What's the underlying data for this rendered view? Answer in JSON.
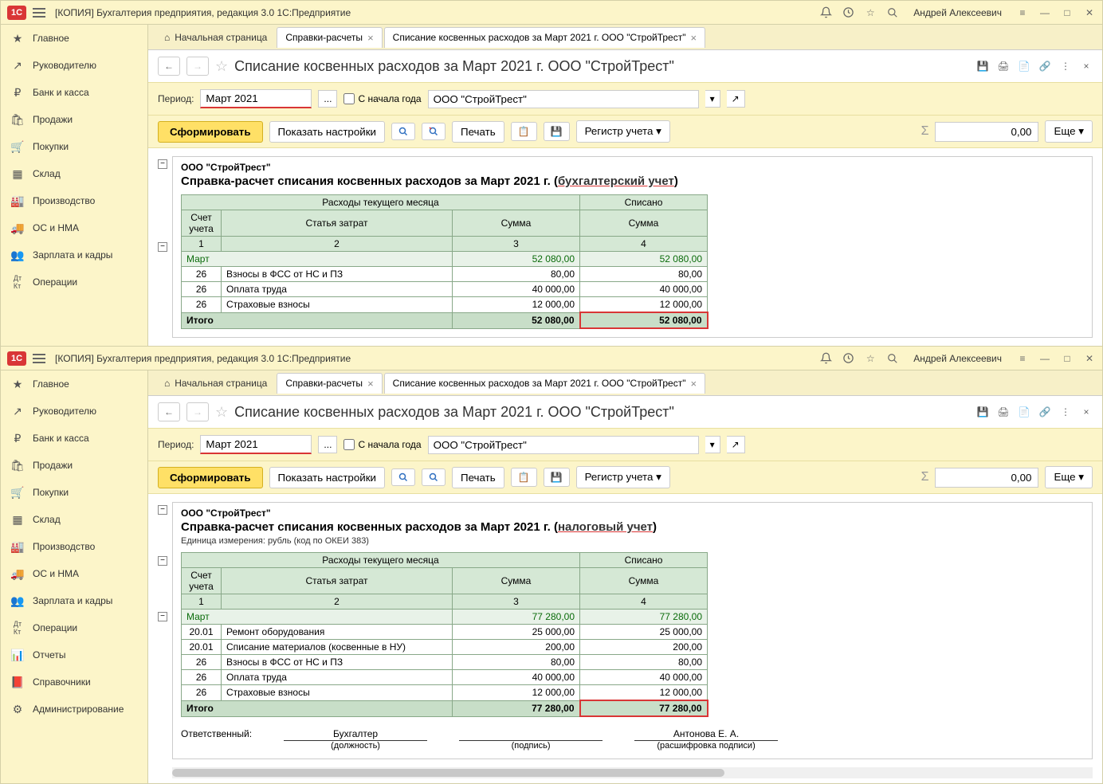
{
  "app": {
    "title": "[КОПИЯ] Бухгалтерия предприятия, редакция 3.0 1С:Предприятие",
    "user": "Андрей Алексеевич"
  },
  "sidebar": {
    "items": [
      {
        "icon": "★",
        "label": "Главное"
      },
      {
        "icon": "↗",
        "label": "Руководителю"
      },
      {
        "icon": "₽",
        "label": "Банк и касса"
      },
      {
        "icon": "🛍",
        "label": "Продажи"
      },
      {
        "icon": "🛒",
        "label": "Покупки"
      },
      {
        "icon": "▦",
        "label": "Склад"
      },
      {
        "icon": "🏭",
        "label": "Производство"
      },
      {
        "icon": "🚚",
        "label": "ОС и НМА"
      },
      {
        "icon": "👥",
        "label": "Зарплата и кадры"
      },
      {
        "icon": "Дт",
        "label": "Операции"
      },
      {
        "icon": "📊",
        "label": "Отчеты"
      },
      {
        "icon": "📕",
        "label": "Справочники"
      },
      {
        "icon": "⚙",
        "label": "Администрирование"
      }
    ]
  },
  "tabs": {
    "home": "Начальная страница",
    "t1": "Справки-расчеты",
    "t2": "Списание косвенных расходов за Март 2021 г. ООО \"СтройТрест\""
  },
  "page": {
    "title": "Списание косвенных расходов за Март 2021 г. ООО \"СтройТрест\""
  },
  "params": {
    "period_label": "Период:",
    "period_value": "Март 2021",
    "year_start": "С начала года",
    "org": "ООО \"СтройТрест\""
  },
  "toolbar": {
    "form": "Сформировать",
    "settings": "Показать настройки",
    "print": "Печать",
    "register": "Регистр учета",
    "more": "Еще",
    "sum_value": "0,00"
  },
  "report_top": {
    "org": "ООО \"СтройТрест\"",
    "title_prefix": "Справка-расчет списания косвенных расходов за Март 2021 г. (",
    "title_u": "бухгалтерский учет",
    "title_suffix": ")",
    "headers": {
      "expenses": "Расходы текущего месяца",
      "written": "Списано",
      "account": "Счет учета",
      "article": "Статья затрат",
      "sum": "Сумма",
      "c1": "1",
      "c2": "2",
      "c3": "3",
      "c4": "4"
    },
    "month": "Март",
    "month_sum": "52 080,00",
    "rows": [
      {
        "acct": "26",
        "art": "Взносы в ФСС от НС и ПЗ",
        "s1": "80,00",
        "s2": "80,00"
      },
      {
        "acct": "26",
        "art": "Оплата труда",
        "s1": "40 000,00",
        "s2": "40 000,00"
      },
      {
        "acct": "26",
        "art": "Страховые взносы",
        "s1": "12 000,00",
        "s2": "12 000,00"
      }
    ],
    "total_label": "Итого",
    "total": "52 080,00"
  },
  "report_bottom": {
    "org": "ООО \"СтройТрест\"",
    "title_prefix": "Справка-расчет списания косвенных расходов за Март 2021 г. (",
    "title_u": "налоговый учет",
    "title_suffix": ")",
    "measure": "Единица измерения:  рубль (код по ОКЕИ 383)",
    "headers": {
      "expenses": "Расходы текущего месяца",
      "written": "Списано",
      "account": "Счет учета",
      "article": "Статья затрат",
      "sum": "Сумма",
      "c1": "1",
      "c2": "2",
      "c3": "3",
      "c4": "4"
    },
    "month": "Март",
    "month_sum": "77 280,00",
    "rows": [
      {
        "acct": "20.01",
        "art": "Ремонт оборудования",
        "s1": "25 000,00",
        "s2": "25 000,00"
      },
      {
        "acct": "20.01",
        "art": "Списание материалов (косвенные в НУ)",
        "s1": "200,00",
        "s2": "200,00"
      },
      {
        "acct": "26",
        "art": "Взносы в ФСС от НС и ПЗ",
        "s1": "80,00",
        "s2": "80,00"
      },
      {
        "acct": "26",
        "art": "Оплата труда",
        "s1": "40 000,00",
        "s2": "40 000,00"
      },
      {
        "acct": "26",
        "art": "Страховые взносы",
        "s1": "12 000,00",
        "s2": "12 000,00"
      }
    ],
    "total_label": "Итого",
    "total": "77 280,00",
    "sign": {
      "resp": "Ответственный:",
      "acct": "Бухгалтер",
      "pos": "(должность)",
      "sig": "(подпись)",
      "name": "Антонова Е. А.",
      "decode": "(расшифровка подписи)"
    }
  }
}
